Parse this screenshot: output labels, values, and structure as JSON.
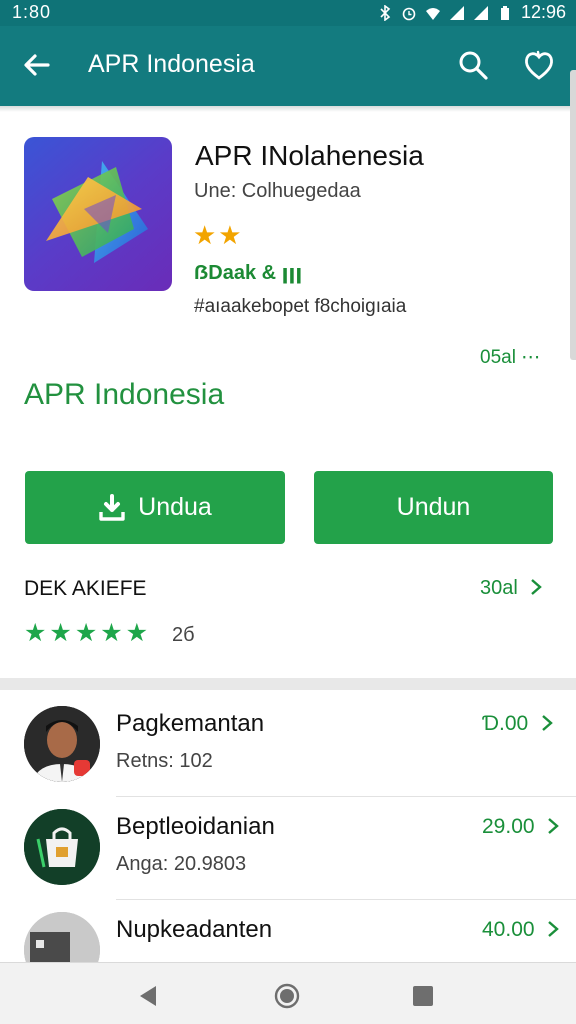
{
  "status": {
    "time_left": "1:80",
    "time_right": "12:96"
  },
  "appbar": {
    "title": "APR Indonesia"
  },
  "app": {
    "name": "APR INolahenesia",
    "developer": "Une: Colhuegedaa",
    "stars": "★★",
    "badge": "ẞDaak & ꞁꞁꞁ",
    "tags": "#aıaakebopet f8choigıaia",
    "more_link": "05al ⋯"
  },
  "brand": {
    "name": "APR Indonesia"
  },
  "buttons": {
    "download_primary": "Undua",
    "download_secondary": "Undun"
  },
  "ratings": {
    "title": "DEK AKIEFE",
    "link": "30al",
    "stars": "★★★★★",
    "count": "2б"
  },
  "list": [
    {
      "title": "Pagkemantan",
      "subtitle": "Retns: 102",
      "price": "Ɗ.00"
    },
    {
      "title": "Beptleoidanian",
      "subtitle": "Anga: 20.9803",
      "price": "29.00"
    },
    {
      "title": "Nupkeadanten",
      "subtitle": "",
      "price": "40.00"
    }
  ],
  "colors": {
    "appbar": "#137b7f",
    "accent_green": "#23a24a",
    "star_gold": "#f2a400"
  },
  "icons": [
    "back-arrow-icon",
    "search-icon",
    "heart-icon",
    "download-icon",
    "chevron-right-icon",
    "nav-back-icon",
    "nav-home-icon",
    "nav-recents-icon"
  ]
}
